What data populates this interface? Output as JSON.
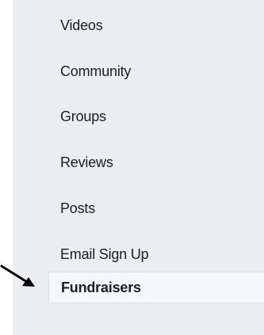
{
  "sidebar": {
    "items": [
      {
        "label": "Videos"
      },
      {
        "label": "Community"
      },
      {
        "label": "Groups"
      },
      {
        "label": "Reviews"
      },
      {
        "label": "Posts"
      },
      {
        "label": "Email Sign Up"
      },
      {
        "label": "Fundraisers",
        "active": true
      }
    ]
  },
  "annotation": {
    "icon": "arrow-pointer-icon",
    "color": "#000000"
  },
  "colors": {
    "sidebar_bg": "#ebedf0",
    "active_bg": "#f6f7f9",
    "text": "#1c1e21"
  }
}
